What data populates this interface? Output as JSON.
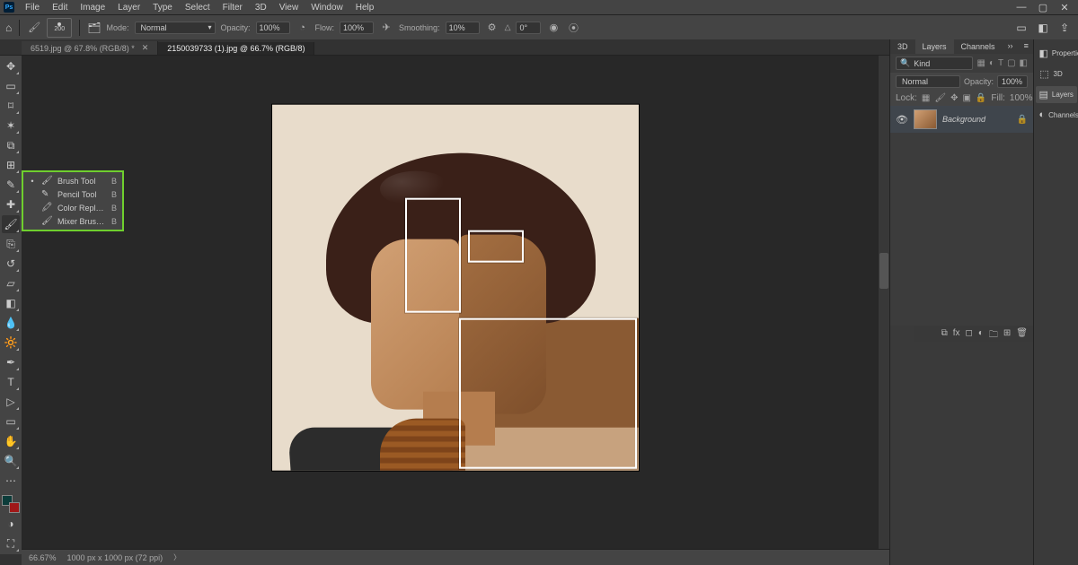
{
  "menu": [
    "File",
    "Edit",
    "Image",
    "Layer",
    "Type",
    "Select",
    "Filter",
    "3D",
    "View",
    "Window",
    "Help"
  ],
  "options": {
    "brush_size": "200",
    "mode_label": "Mode:",
    "mode_value": "Normal",
    "opacity_label": "Opacity:",
    "opacity_value": "100%",
    "flow_label": "Flow:",
    "flow_value": "100%",
    "smoothing_label": "Smoothing:",
    "smoothing_value": "10%",
    "angle_label": "△",
    "angle_value": "0°"
  },
  "tabs": [
    {
      "label": "6519.jpg @ 67.8% (RGB/8) *",
      "active": false
    },
    {
      "label": "2150039733 (1).jpg @ 66.7% (RGB/8)",
      "active": true
    }
  ],
  "brush_flyout": [
    {
      "label": "Brush Tool",
      "key": "B",
      "selected": true
    },
    {
      "label": "Pencil Tool",
      "key": "B",
      "selected": false
    },
    {
      "label": "Color Replacement Tool",
      "key": "B",
      "selected": false
    },
    {
      "label": "Mixer Brush Tool",
      "key": "B",
      "selected": false
    }
  ],
  "panels": {
    "tabs": [
      "3D",
      "Layers",
      "Channels"
    ],
    "active_tab": 1,
    "search_placeholder": "Kind",
    "blend_mode": "Normal",
    "opacity_label": "Opacity:",
    "opacity_value": "100%",
    "lock_label": "Lock:",
    "fill_label": "Fill:",
    "fill_value": "100%",
    "layer_name": "Background"
  },
  "right_iconbar": [
    {
      "icon": "◧",
      "label": "Properties"
    },
    {
      "icon": "⬚",
      "label": "3D"
    },
    {
      "icon": "▤",
      "label": "Layers",
      "active": true
    },
    {
      "icon": "◐",
      "label": "Channels"
    }
  ],
  "status": {
    "zoom": "66.67%",
    "docinfo": "1000 px x 1000 px (72 ppi)"
  },
  "colors": {
    "fg": "#0c3c3a",
    "bg": "#a01818"
  }
}
